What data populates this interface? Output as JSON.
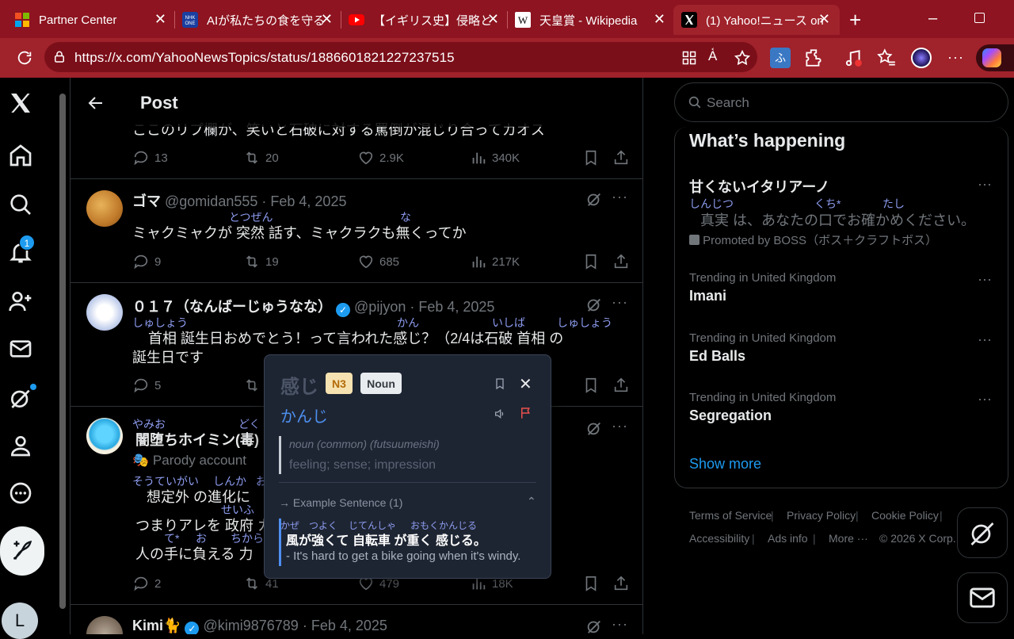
{
  "browser": {
    "tabs": [
      {
        "title": "Partner Center"
      },
      {
        "title": "AIが私たちの食を守る？"
      },
      {
        "title": "【イギリス史】侵略と支配"
      },
      {
        "title": "天皇賞 - Wikipedia"
      },
      {
        "title": "(1) Yahoo!ニュース on X"
      }
    ],
    "url": "https://x.com/YahooNewsTopics/status/1886601821227237515"
  },
  "nav": {
    "notification_count": "1",
    "account_initial": "L"
  },
  "header": {
    "title": "Post"
  },
  "posts": [
    {
      "partial_text": "ここのリプ欄が、笑いと石破に対する罵倒が混じり合ってカオス",
      "stats": {
        "replies": "13",
        "reposts": "20",
        "likes": "2.9K",
        "views": "340K"
      }
    },
    {
      "name": "ゴマ",
      "handle": "@gomidan555",
      "date": "· Feb 4, 2025",
      "ruby": [
        "とつぜん",
        "な"
      ],
      "text": "ミャクミャクが 突然 話す、ミャクラクも無くってか",
      "stats": {
        "replies": "9",
        "reposts": "19",
        "likes": "685",
        "views": "217K"
      }
    },
    {
      "name": "０１７（なんばーじゅうなな）",
      "handle": "@pijyon",
      "date": "· Feb 4, 2025",
      "ruby": [
        "しゅしょう",
        "かん",
        "いしば",
        "しゅしょう"
      ],
      "line1": "首相 誕生日おめでとう！って言われた感じ？（2/4は石破 首相 の",
      "line2": "誕生日です",
      "stats": {
        "replies": "5"
      }
    },
    {
      "name": "闇堕ちホイミン(毒)",
      "name_ruby": [
        "やみお",
        "どく"
      ],
      "badge": "Parody account",
      "ruby": [
        "そうていがい",
        "しんか",
        "お"
      ],
      "line1": "想定外 の進化に",
      "ruby2": [
        "せいふ"
      ],
      "line2": "つまりアレを 政府 カ",
      "ruby3": [
        "て*",
        "お",
        "ちから"
      ],
      "line3": "人の手に負える 力",
      "stats": {
        "replies": "2",
        "reposts": "41",
        "likes": "479",
        "views": "18K"
      }
    },
    {
      "name": "Kimi",
      "handle": "@kimi9876789",
      "date": "· Feb 4, 2025"
    }
  ],
  "right": {
    "search_placeholder": "Search",
    "section_title": "What’s happening",
    "promo": {
      "title": "甘くないイタリアーノ",
      "ruby": [
        "しんじつ",
        "くち*",
        "たし"
      ],
      "text": "真実 は、あなたの口でお確かめください。",
      "by": "Promoted by BOSS（ボス＋クラフトボス）"
    },
    "trends": [
      {
        "meta": "Trending in United Kingdom",
        "name": "Imani"
      },
      {
        "meta": "Trending in United Kingdom",
        "name": "Ed Balls"
      },
      {
        "meta": "Trending in United Kingdom",
        "name": "Segregation"
      }
    ],
    "show_more": "Show more",
    "footer": [
      "Terms of Service",
      "Privacy Policy",
      "Cookie Policy",
      "Accessibility",
      "Ads info",
      "More ···",
      "© 2026 X Corp."
    ]
  },
  "popup": {
    "word": "感じ",
    "level": "N3",
    "pos": "Noun",
    "reading": "かんじ",
    "def_type": "noun (common) (futsuumeishi)",
    "definition": "feeling; sense; impression",
    "example_header": "→ Example Sentence (1)",
    "example_ruby": [
      "かぜ",
      "つよく",
      "じてんしゃ",
      "おもくかんじる"
    ],
    "example_jp": "風が強くて 自転車 が重く 感じる。",
    "example_en": "- It's hard to get a bike going when it's windy."
  },
  "colors": {
    "browser": "#a0222b",
    "accent": "#1d9bf0",
    "ruby": "#8d9cf0"
  }
}
